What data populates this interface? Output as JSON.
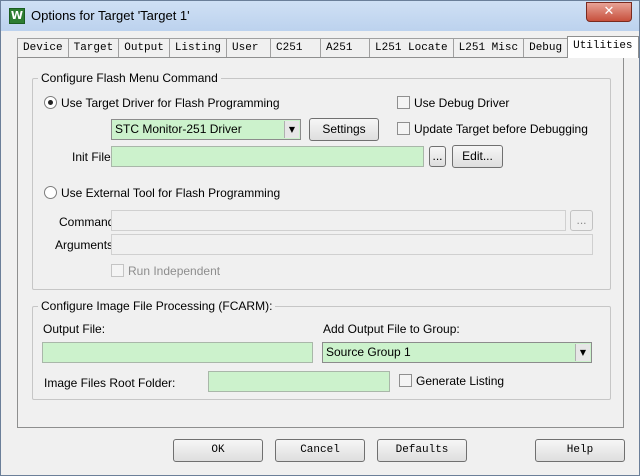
{
  "window": {
    "title": "Options for Target 'Target 1'",
    "close_glyph": "✕",
    "app_icon_letter": "W"
  },
  "tabs": [
    {
      "label": "Device"
    },
    {
      "label": "Target"
    },
    {
      "label": "Output"
    },
    {
      "label": "Listing"
    },
    {
      "label": "User"
    },
    {
      "label": "C251"
    },
    {
      "label": "A251"
    },
    {
      "label": "L251 Locate"
    },
    {
      "label": "L251 Misc"
    },
    {
      "label": "Debug"
    },
    {
      "label": "Utilities",
      "active": true
    }
  ],
  "flash": {
    "group_label": "Configure Flash Menu Command",
    "use_target_driver_label": "Use Target Driver for Flash Programming",
    "use_target_driver_selected": true,
    "driver_value": "STC Monitor-251 Driver",
    "settings_label": "Settings",
    "use_debug_driver_label": "Use Debug Driver",
    "use_debug_driver_checked": false,
    "update_target_label": "Update Target before Debugging",
    "update_target_checked": false,
    "init_file_label": "Init File:",
    "init_file_value": "",
    "browse_label": "...",
    "edit_label": "Edit...",
    "use_external_tool_label": "Use External Tool for Flash Programming",
    "use_external_tool_selected": false,
    "command_label": "Command:",
    "command_browse_label": "...",
    "arguments_label": "Arguments:",
    "run_independent_label": "Run Independent",
    "run_independent_checked": false
  },
  "image": {
    "group_label": "Configure Image File Processing (FCARM):",
    "output_file_label": "Output File:",
    "output_file_value": "",
    "add_output_label": "Add Output File  to Group:",
    "group_value": "Source Group 1",
    "root_folder_label": "Image Files Root Folder:",
    "root_folder_value": "",
    "generate_listing_label": "Generate Listing",
    "generate_listing_checked": false
  },
  "footer": {
    "ok_label": "OK",
    "cancel_label": "Cancel",
    "defaults_label": "Defaults",
    "help_label": "Help"
  },
  "colors": {
    "field_bg": "#ccf2cc",
    "dialog_bg": "#f0f0f0",
    "title_bar": "#bcd2ee"
  }
}
